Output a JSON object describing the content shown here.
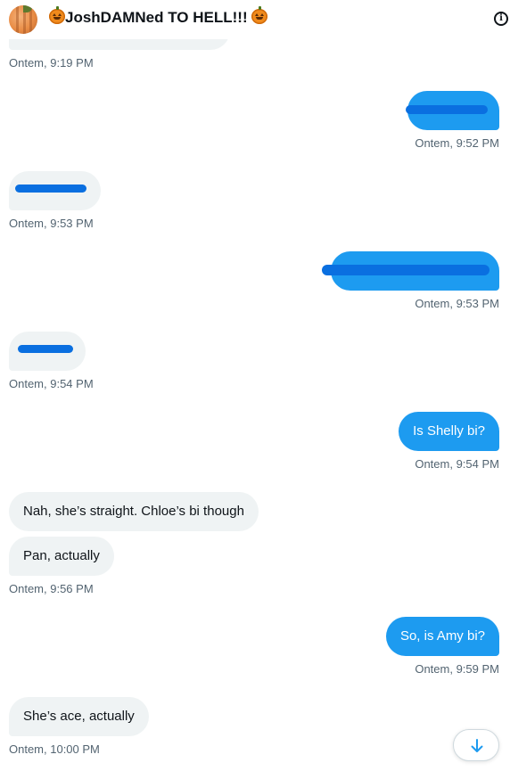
{
  "header": {
    "title": "JoshDAMNed TO HELL!!!",
    "info_icon": "info-icon",
    "avatar_icon": "pumpkin-avatar-icon"
  },
  "messages": [
    {
      "from": "them",
      "text": "",
      "redacted": true,
      "time": "Ontem, 9:19 PM"
    },
    {
      "from": "me",
      "text": "",
      "redacted": true,
      "time": "Ontem, 9:52 PM"
    },
    {
      "from": "them",
      "text": "",
      "redacted": true,
      "time": "Ontem, 9:53 PM"
    },
    {
      "from": "me",
      "text": "",
      "redacted": true,
      "time": "Ontem, 9:53 PM"
    },
    {
      "from": "them",
      "text": "",
      "redacted": true,
      "time": "Ontem, 9:54 PM"
    },
    {
      "from": "me",
      "text": "Is Shelly bi?",
      "time": "Ontem, 9:54 PM"
    },
    {
      "from": "them",
      "text": "Nah, she’s straight. Chloe’s bi though"
    },
    {
      "from": "them",
      "text": "Pan, actually",
      "time": "Ontem, 9:56 PM"
    },
    {
      "from": "me",
      "text": "So, is Amy bi?",
      "time": "Ontem, 9:59 PM"
    },
    {
      "from": "them",
      "text": "She’s ace, actually",
      "time": "Ontem, 10:00 PM"
    }
  ],
  "colors": {
    "outgoing_bubble": "#1d9bf0",
    "incoming_bubble": "#eff3f4",
    "timestamp": "#536471",
    "redaction": "#0a6fe0"
  },
  "scroll_button_icon": "arrow-down-icon"
}
